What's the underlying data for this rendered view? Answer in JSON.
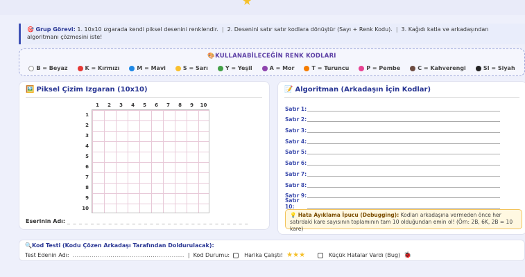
{
  "task_bar": {
    "label": "Grup Görevi:",
    "steps": [
      "1. 10x10 ızgarada kendi piksel desenini renklendir.",
      "2. Desenini satır satır kodlara dönüştür (Sayı + Renk Kodu).",
      "3. Kağıdı katla ve arkadaşından algoritmanı çözmesini iste!"
    ]
  },
  "color_codes": {
    "title": "KULLANABİLECEĞİN RENK KODLARI",
    "items": [
      {
        "label": "B = Beyaz",
        "color": "#ffffff"
      },
      {
        "label": "K = Kırmızı",
        "color": "#e53935"
      },
      {
        "label": "M = Mavi",
        "color": "#1e88e5"
      },
      {
        "label": "S = Sarı",
        "color": "#f9c02e"
      },
      {
        "label": "Y = Yeşil",
        "color": "#43a047"
      },
      {
        "label": "A = Mor",
        "color": "#8e44ad"
      },
      {
        "label": "T = Turuncu",
        "color": "#f57c00"
      },
      {
        "label": "P = Pembe",
        "color": "#e84393"
      },
      {
        "label": "C = Kahverengi",
        "color": "#6d4c41"
      },
      {
        "label": "SI = Siyah",
        "color": "#222222"
      }
    ]
  },
  "grid_card": {
    "title": "Piksel Çizim Izgaran (10x10)",
    "columns": [
      "1",
      "2",
      "3",
      "4",
      "5",
      "6",
      "7",
      "8",
      "9",
      "10"
    ],
    "rows": [
      "1",
      "2",
      "3",
      "4",
      "5",
      "6",
      "7",
      "8",
      "9",
      "10"
    ],
    "artist_label": "Eserinin Adı:"
  },
  "algorithm_card": {
    "title": "Algoritman (Arkadaşın İçin Kodlar)",
    "rows": [
      "Satır 1:",
      "Satır 2:",
      "Satır 3:",
      "Satır 4:",
      "Satır 5:",
      "Satır 6:",
      "Satır 7:",
      "Satır 8:",
      "Satır 9:",
      "Satır 10:"
    ],
    "tip_label": "Hata Ayıklama İpucu (Debugging):",
    "tip_text": "Kodları arkadaşına vermeden önce her satırdaki kare sayısının toplamının tam 10 olduğundan emin ol! (Örn: 2B, 6K, 2B = 10 kare)"
  },
  "test": {
    "title": "Kod Testi (Kodu Çözen Arkadaşı Tarafından Doldurulacak):",
    "tester_label": "Test Edenin Adı:",
    "status_label": "Kod Durumu:",
    "option_success": "Harika Çalıştı!",
    "option_bug": "Küçük Hatalar Vardı (Bug)"
  }
}
